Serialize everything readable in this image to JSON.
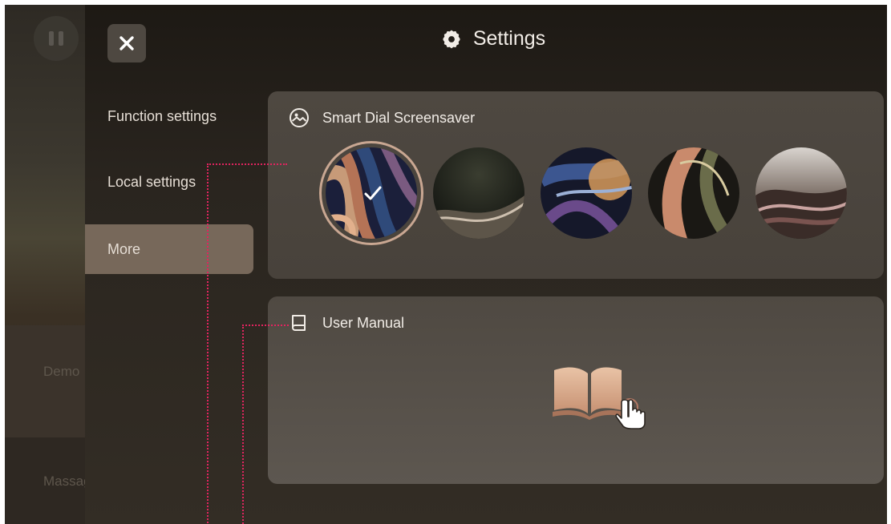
{
  "background_app": {
    "items": [
      "Demo",
      "Massage"
    ]
  },
  "header": {
    "title": "Settings",
    "close_icon": "close-icon",
    "title_icon": "gear-icon"
  },
  "sidebar": {
    "items": [
      {
        "label": "Function settings",
        "active": false
      },
      {
        "label": "Local settings",
        "active": false
      },
      {
        "label": "More",
        "active": true
      }
    ]
  },
  "screensaver": {
    "title": "Smart Dial Screensaver",
    "icon": "image-icon",
    "selected_index": 0,
    "dial_count": 5
  },
  "manual": {
    "title": "User Manual",
    "icon": "book-icon",
    "action_icon": "open-book-hand-icon"
  },
  "colors": {
    "accent": "#c9a792",
    "active_menu": "#77685a",
    "annotation_line": "#e0245e"
  }
}
